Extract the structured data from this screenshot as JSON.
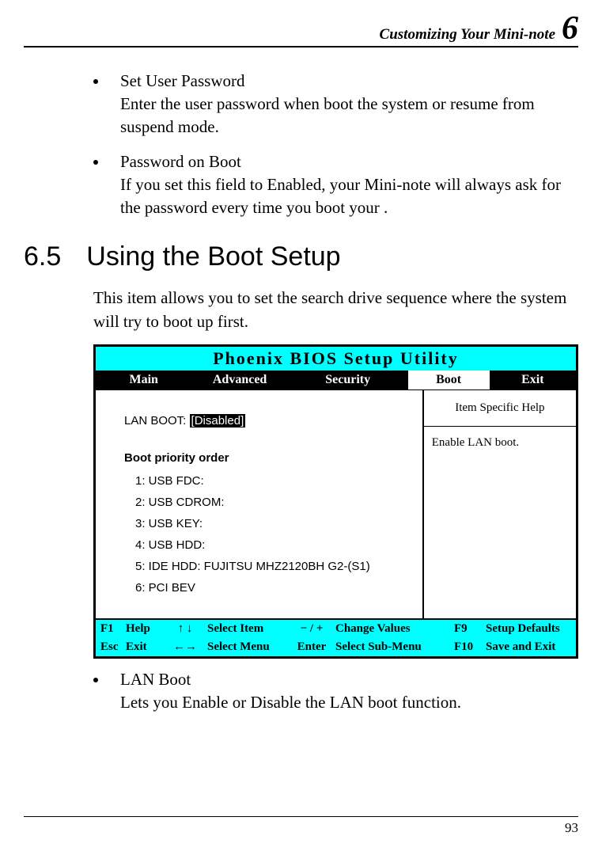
{
  "header": {
    "title": "Customizing Your Mini-note",
    "chapter": "6"
  },
  "bullets_top": [
    {
      "title": "Set User Password",
      "desc": "Enter the user password when boot the system or resume from suspend mode."
    },
    {
      "title": "Password on Boot",
      "desc": "If you set this field to Enabled, your Mini-note will always ask for the password every time you boot your ."
    }
  ],
  "section": {
    "number": "6.5",
    "title": "Using the Boot Setup",
    "desc": "This item allows you to set the search drive sequence where the system will try to boot up first."
  },
  "bios": {
    "title": "Phoenix BIOS Setup Utility",
    "tabs": {
      "main": "Main",
      "advanced": "Advanced",
      "security": "Security",
      "boot": "Boot",
      "exit": "Exit"
    },
    "lan_boot_label": "LAN BOOT:",
    "lan_boot_value": "[Disabled]",
    "boot_order_title": "Boot priority order",
    "boot_order": [
      "1: USB FDC:",
      "2: USB CDROM:",
      "3: USB KEY:",
      "4: USB HDD:",
      "5: IDE HDD: FUJITSU MHZ2120BH G2-(S1)",
      "6: PCI BEV"
    ],
    "help_header": "Item Specific Help",
    "help_body": "Enable LAN boot.",
    "footer": {
      "r1": {
        "k1": "F1",
        "l1": "Help",
        "arr": "↑ ↓",
        "a1": "Select Item",
        "k2": "− / +",
        "a2": "Change Values",
        "k3": "F9",
        "a3": "Setup Defaults"
      },
      "r2": {
        "k1": "Esc",
        "l1": "Exit",
        "arr": "←→",
        "a1": "Select Menu",
        "k2": "Enter",
        "a2": "Select Sub-Menu",
        "k3": "F10",
        "a3": "Save and Exit"
      }
    }
  },
  "bullets_bottom": [
    {
      "title": "LAN Boot",
      "desc": "Lets you Enable or Disable the LAN boot function."
    }
  ],
  "page_number": "93"
}
